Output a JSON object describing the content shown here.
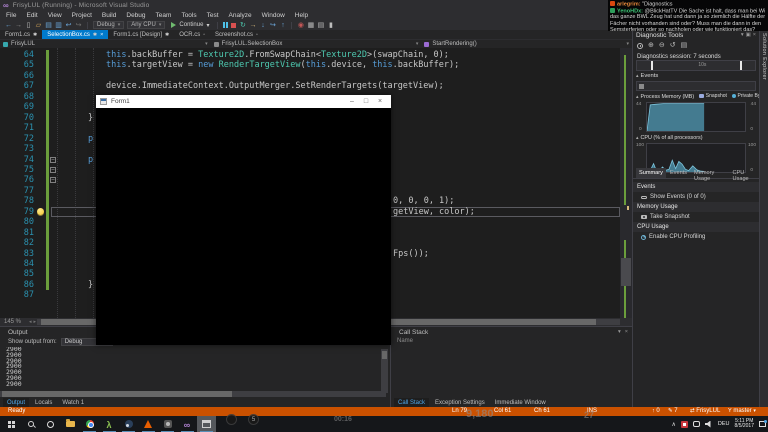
{
  "window": {
    "title": "FrisyLUL (Running) - Microsoft Visual Studio"
  },
  "menu": [
    "File",
    "Edit",
    "View",
    "Project",
    "Build",
    "Debug",
    "Team",
    "Tools",
    "Test",
    "Analyze",
    "Window",
    "Help"
  ],
  "toolbar": {
    "icons_left": [
      "navigate-back",
      "navigate-forward",
      "new-file",
      "open-file",
      "save",
      "save-all",
      "undo",
      "redo"
    ],
    "debug_config": "Debug",
    "platform": "Any CPU",
    "continue_label": "Continue",
    "icons_debug": [
      "pause",
      "stop-debug",
      "restart",
      "show-next-statement",
      "step-into",
      "step-over",
      "step-out"
    ],
    "icons_right": [
      "breakpoints-window",
      "memory-window",
      "immediate-window",
      "bookmark"
    ]
  },
  "editor_tabs": [
    {
      "label": "Form1.cs",
      "active": false,
      "mark": "modified"
    },
    {
      "label": "SelectionBox.cs",
      "active": true,
      "mark": "modified"
    },
    {
      "label": "Form1.cs [Design]",
      "active": false,
      "mark": "modified"
    },
    {
      "label": "OCR.cs",
      "active": false,
      "mark": "pinned"
    },
    {
      "label": "Screenshot.cs",
      "active": false,
      "mark": "pinned"
    }
  ],
  "breadcrumb": [
    {
      "label": "FrisyLUL"
    },
    {
      "label": "FrisyLUL.SelectionBox"
    },
    {
      "label": "StartRendering()"
    }
  ],
  "editor": {
    "zoom_level": "145 %",
    "lines": [
      {
        "n": "64",
        "indent": 3,
        "segments": [
          [
            "this",
            "kw"
          ],
          [
            ".backBuffer = ",
            "pl"
          ],
          [
            "Texture2D",
            "ty"
          ],
          [
            ".FromSwapChain<",
            "pl"
          ],
          [
            "Texture2D",
            "ty"
          ],
          [
            ">(swapChain, 0);",
            "pl"
          ]
        ]
      },
      {
        "n": "65",
        "indent": 3,
        "segments": [
          [
            "this",
            "kw"
          ],
          [
            ".targetView = ",
            "pl"
          ],
          [
            "new",
            "kw"
          ],
          [
            " ",
            "pl"
          ],
          [
            "RenderTargetView",
            "ty"
          ],
          [
            "(",
            "pl"
          ],
          [
            "this",
            "kw"
          ],
          [
            ".device, ",
            "pl"
          ],
          [
            "this",
            "kw"
          ],
          [
            ".backBuffer);",
            "pl"
          ]
        ]
      },
      {
        "n": "66"
      },
      {
        "n": "67",
        "indent": 3,
        "segments": [
          [
            "device.ImmediateContext.OutputMerger.SetRenderTargets(targetView);",
            "pl"
          ]
        ]
      },
      {
        "n": "68"
      },
      {
        "n": "69"
      },
      {
        "n": "70",
        "indent": 2,
        "segments": [
          [
            "}",
            "pl"
          ]
        ]
      },
      {
        "n": "71"
      },
      {
        "n": "72",
        "indent": 2,
        "segments": [
          [
            "p",
            "kw"
          ]
        ]
      },
      {
        "n": "73"
      },
      {
        "n": "74",
        "indent": 2,
        "collapse": true,
        "segments": [
          [
            "p",
            "kw"
          ]
        ]
      },
      {
        "n": "75",
        "collapse": true
      },
      {
        "n": "76",
        "collapse": true
      },
      {
        "n": "77"
      },
      {
        "n": "78",
        "right": "0, 0, 0, 1);"
      },
      {
        "n": "79",
        "right": "getView, color);",
        "current": true,
        "lightbulb": true
      },
      {
        "n": "80"
      },
      {
        "n": "81"
      },
      {
        "n": "82"
      },
      {
        "n": "83",
        "right": "Fps());"
      },
      {
        "n": "84"
      },
      {
        "n": "85"
      },
      {
        "n": "86",
        "indent": 2,
        "segments": [
          [
            "}",
            "pl"
          ]
        ]
      },
      {
        "n": "87"
      }
    ]
  },
  "form_window": {
    "title": "Form1"
  },
  "output": {
    "title": "Output",
    "filter_label": "Show output from:",
    "filter_value": "Debug",
    "lines": [
      "2900",
      "2900",
      "2900",
      "2900",
      "2900",
      "2900",
      "2900"
    ],
    "tabs": [
      {
        "label": "Output",
        "active": true
      },
      {
        "label": "Locals",
        "active": false
      },
      {
        "label": "Watch 1",
        "active": false
      }
    ]
  },
  "call_stack": {
    "title": "Call Stack",
    "column": "Name",
    "tabs": [
      {
        "label": "Call Stack",
        "active": true
      },
      {
        "label": "Exception Settings",
        "active": false
      },
      {
        "label": "Immediate Window",
        "active": false
      }
    ]
  },
  "diagnostics": {
    "title": "Diagnostic Tools",
    "session": "Diagnostics session: 7 seconds",
    "timeline_tick": "10s",
    "events_track_label": "Events",
    "tabs": [
      {
        "label": "Summary",
        "active": true
      },
      {
        "label": "Events",
        "active": false
      },
      {
        "label": "Memory Usage",
        "active": false
      },
      {
        "label": "CPU Usage",
        "active": false
      }
    ],
    "summary": [
      {
        "header": "Events",
        "action": "Show Events (0 of 0)"
      },
      {
        "header": "Memory Usage",
        "action": "Take Snapshot"
      },
      {
        "header": "CPU Usage",
        "action": "Enable CPU Profiling"
      }
    ]
  },
  "chart_data": [
    {
      "type": "area",
      "title": "Process Memory (MB)",
      "legend": [
        "Snapshot",
        "Private Bytes"
      ],
      "ymax_label": "44",
      "ymin_label": "0",
      "ylim": [
        0,
        44
      ],
      "x_seconds": [
        0,
        0.4,
        1,
        2,
        3,
        4,
        5,
        6,
        7
      ],
      "values": [
        0,
        41,
        42,
        43,
        43,
        43,
        43,
        43,
        43
      ],
      "xmax_seconds": 12,
      "color": "#4E92AC"
    },
    {
      "type": "area",
      "title": "CPU (% of all processors)",
      "ymax_label": "100",
      "ymin_label": "0",
      "ylim": [
        0,
        100
      ],
      "x_seconds": [
        0,
        0.4,
        0.8,
        1.1,
        1.5,
        1.9,
        2.3,
        2.7,
        3.1,
        3.5,
        3.9,
        4.3,
        4.7,
        5.1,
        5.6,
        6.1,
        6.6,
        7
      ],
      "values": [
        2,
        5,
        30,
        8,
        4,
        18,
        6,
        10,
        42,
        12,
        38,
        28,
        10,
        5,
        22,
        8,
        3,
        2
      ],
      "xmax_seconds": 12,
      "color": "#4E92AC"
    }
  ],
  "chat": {
    "messages": [
      {
        "user": "arlegrim",
        "color": "#e8893b",
        "badge": "#d9480f",
        "text": "\"Diagnostics"
      },
      {
        "user": "YenoHDx",
        "color": "#3ec878",
        "badge": "#2e9e5b",
        "text": "@BlickHatTV Die Sache ist halt, dass man bei Wi das ganze BWL Zeug hat und dann ja so ziemlich die Hälfte der Fächer nicht vorhanden sind oder? Muss man die dann in den Semsterferien oder so nachholen oder wie funktioniert das?"
      }
    ]
  },
  "status_bar": {
    "state": "Ready",
    "line": "Ln 79",
    "column": "Col 61",
    "character": "Ch 61",
    "mode": "INS",
    "pending_pushes": "0",
    "pending_edits": "7",
    "repo": "FrisyLUL",
    "branch": "master",
    "background": "#CA5100"
  },
  "taskbar": {
    "apps": [
      {
        "name": "start",
        "running": false,
        "active": false
      },
      {
        "name": "search",
        "running": false,
        "active": false
      },
      {
        "name": "cortana",
        "running": false,
        "active": false
      },
      {
        "name": "file-explorer",
        "running": false,
        "active": false
      },
      {
        "name": "chrome",
        "running": true,
        "active": false
      },
      {
        "name": "half-life-lambda",
        "running": true,
        "active": false
      },
      {
        "name": "steam",
        "running": true,
        "active": false
      },
      {
        "name": "vlc",
        "running": true,
        "active": false
      },
      {
        "name": "paint-app",
        "running": true,
        "active": false
      },
      {
        "name": "visual-studio",
        "running": true,
        "active": false
      },
      {
        "name": "form1-app",
        "running": true,
        "active": true
      }
    ],
    "tray": {
      "language": "DEU",
      "time": "5:11 PM",
      "date": "8/5/2017"
    }
  },
  "stream_overlay": {
    "sub_count": "5",
    "timer": "00:16",
    "counter_large": "9,180",
    "counter_small": "27"
  },
  "side_tab": {
    "label": "Solution Explorer"
  }
}
